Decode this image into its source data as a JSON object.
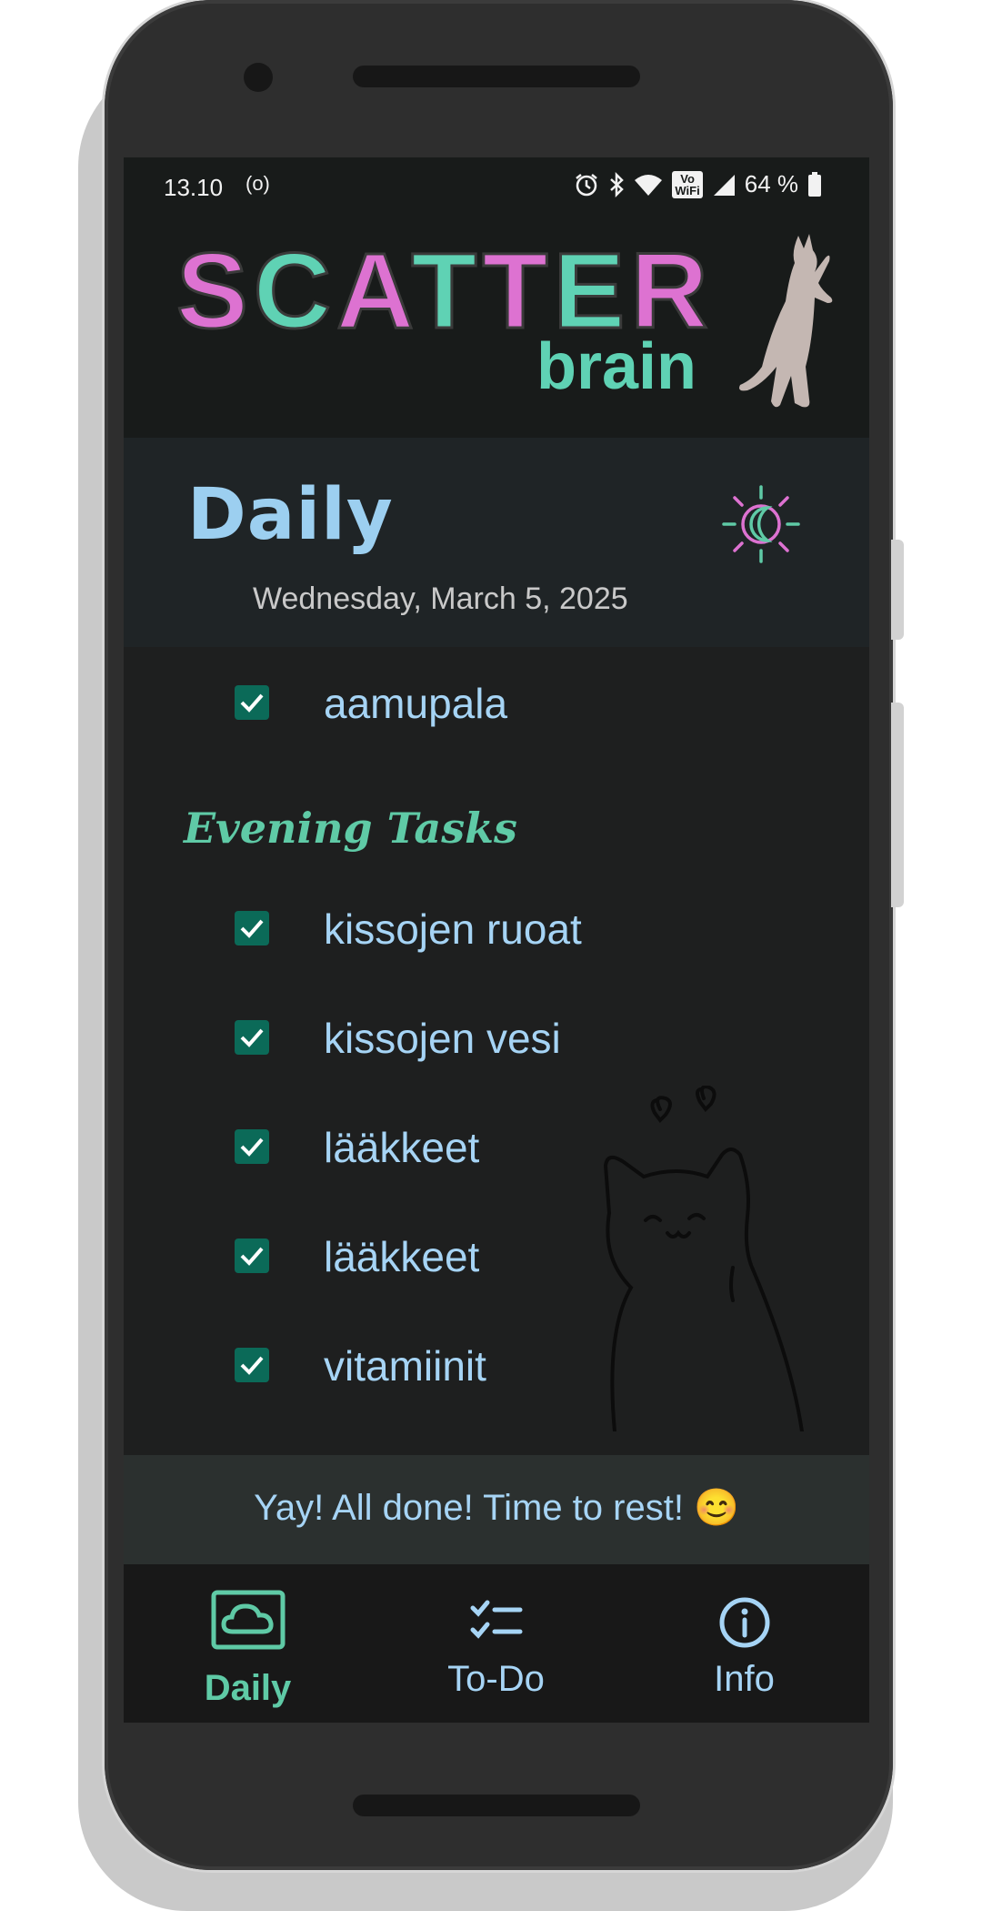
{
  "status_bar": {
    "time": "13.10",
    "hotspot_symbol": "(o)",
    "volte_top": "Vo",
    "volte_bottom": "WiFi",
    "battery": "64 %",
    "icons": [
      "hotspot-icon",
      "alarm-icon",
      "bluetooth-icon",
      "wifi-icon",
      "volte-icon",
      "signal-icon",
      "battery-icon"
    ]
  },
  "header": {
    "logo_letters": [
      "S",
      "C",
      "A",
      "T",
      "T",
      "E",
      "R"
    ],
    "logo_sub": "brain",
    "logo_colors": {
      "pink": "#dd72d1",
      "mint": "#5fd2b4"
    }
  },
  "page": {
    "title": "Daily",
    "date": "Wednesday, March 5, 2025",
    "theme_toggle_icon": "sun-moon-icon"
  },
  "tasks": {
    "morning": [
      {
        "label": "aamupala",
        "checked": true
      }
    ],
    "evening_heading": "Evening Tasks",
    "evening": [
      {
        "label": "kissojen ruoat",
        "checked": true
      },
      {
        "label": "kissojen vesi",
        "checked": true
      },
      {
        "label": "lääkkeet",
        "checked": true
      },
      {
        "label": "lääkkeet",
        "checked": true
      },
      {
        "label": "vitamiinit",
        "checked": true
      }
    ]
  },
  "banner": {
    "text": "Yay! All done! Time to rest! 😊"
  },
  "bottom_nav": {
    "items": [
      {
        "label": "Daily",
        "icon": "cloud-icon",
        "active": true
      },
      {
        "label": "To-Do",
        "icon": "checklist-icon",
        "active": false
      },
      {
        "label": "Info",
        "icon": "info-icon",
        "active": false
      }
    ]
  },
  "colors": {
    "accent_mint": "#5fcaa6",
    "text_blue": "#a6d4f5",
    "checkbox": "#0b6a58",
    "background": "#1e1f1f"
  }
}
